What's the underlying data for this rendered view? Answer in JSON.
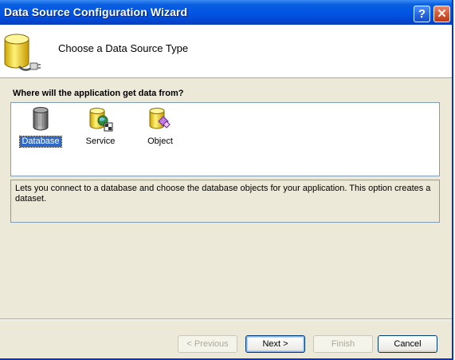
{
  "window": {
    "title": "Data Source Configuration Wizard",
    "help_glyph": "?",
    "close_glyph": "✕"
  },
  "header": {
    "title": "Choose a Data Source Type",
    "icon": "database-plug-icon"
  },
  "prompt": "Where will the application get data from?",
  "sources": [
    {
      "label": "Database",
      "icon": "database-icon",
      "selected": true
    },
    {
      "label": "Service",
      "icon": "service-icon",
      "selected": false
    },
    {
      "label": "Object",
      "icon": "object-icon",
      "selected": false
    }
  ],
  "description": "Lets you connect to a database and choose the database objects for your application. This option creates a dataset.",
  "buttons": {
    "previous": "< Previous",
    "next": "Next >",
    "finish": "Finish",
    "cancel": "Cancel"
  },
  "colors": {
    "titlebar": "#0054e3",
    "selection": "#316ac5",
    "dialog_bg": "#ece9d8"
  }
}
